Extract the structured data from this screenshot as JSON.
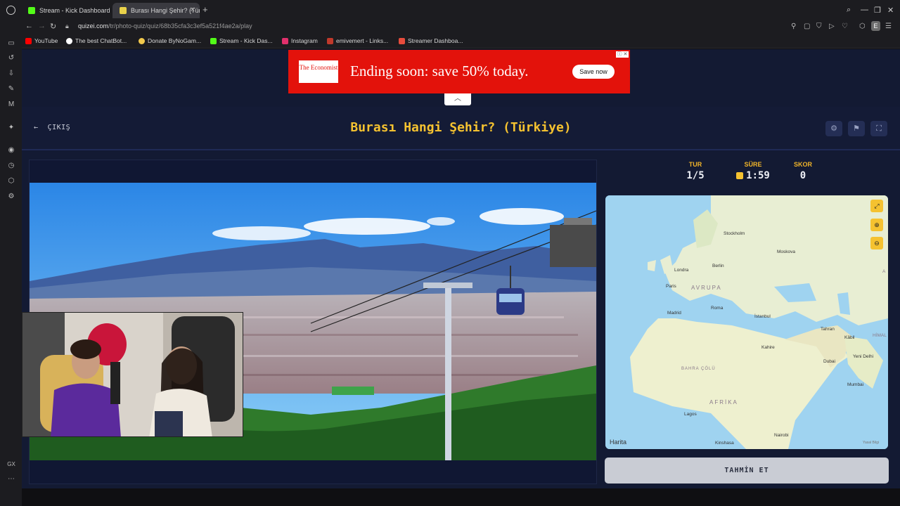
{
  "browser": {
    "tabs": [
      {
        "title": "Stream - Kick Dashboard",
        "favicon_color": "#53fc18"
      },
      {
        "title": "Burası Hangi Şehir? (Türk",
        "favicon_color": "#e8d14a"
      }
    ],
    "url_host": "quizei.com",
    "url_path": "/tr/photo-quiz/quiz/68b35cfa3c3ef5a521f4ae2a/play",
    "profile_initial": "E",
    "bookmarks": [
      {
        "label": "YouTube",
        "color": "#ff0000"
      },
      {
        "label": "The best ChatBot...",
        "color": "#ffffff"
      },
      {
        "label": "Donate ByNoGam...",
        "color": "#f2c94c"
      },
      {
        "label": "Stream - Kick Das...",
        "color": "#53fc18"
      },
      {
        "label": "Instagram",
        "color": "#e1306c"
      },
      {
        "label": "emivemert - Links...",
        "color": "#c0392b"
      },
      {
        "label": "Streamer Dashboa...",
        "color": "#e74c3c"
      }
    ]
  },
  "ad": {
    "logo_text": "The Economist",
    "headline": "Ending soon: save 50% today.",
    "cta": "Save now",
    "brand_color": "#e3120b"
  },
  "header": {
    "exit_label": "ÇIKIŞ",
    "title": "Burası Hangi Şehir? (Türkiye)",
    "title_color": "#f5c230"
  },
  "stats": {
    "round_label": "TUR",
    "round_value": "1/5",
    "time_label": "SÜRE",
    "time_value": "1:59",
    "score_label": "SKOR",
    "score_value": "0"
  },
  "map": {
    "attribution": "Harita",
    "legal": "Yasal Bilgi",
    "labels": [
      {
        "text": "Stockholm"
      },
      {
        "text": "Moskova"
      },
      {
        "text": "Londra"
      },
      {
        "text": "Berlin"
      },
      {
        "text": "Paris"
      },
      {
        "text": "AVRUPA"
      },
      {
        "text": "Madrid"
      },
      {
        "text": "Roma"
      },
      {
        "text": "İstanbul"
      },
      {
        "text": "Tahran"
      },
      {
        "text": "Kâbil"
      },
      {
        "text": "Kahire"
      },
      {
        "text": "BAHRA ÇÖLÜ"
      },
      {
        "text": "Dubai"
      },
      {
        "text": "Yeni Delhi"
      },
      {
        "text": "Mumbai"
      },
      {
        "text": "AFRİKA"
      },
      {
        "text": "Lagos"
      },
      {
        "text": "Nairobi"
      },
      {
        "text": "Kinshasa"
      },
      {
        "text": "HİMAL"
      },
      {
        "text": "A"
      }
    ]
  },
  "guess_button": "TAHMİN ET"
}
